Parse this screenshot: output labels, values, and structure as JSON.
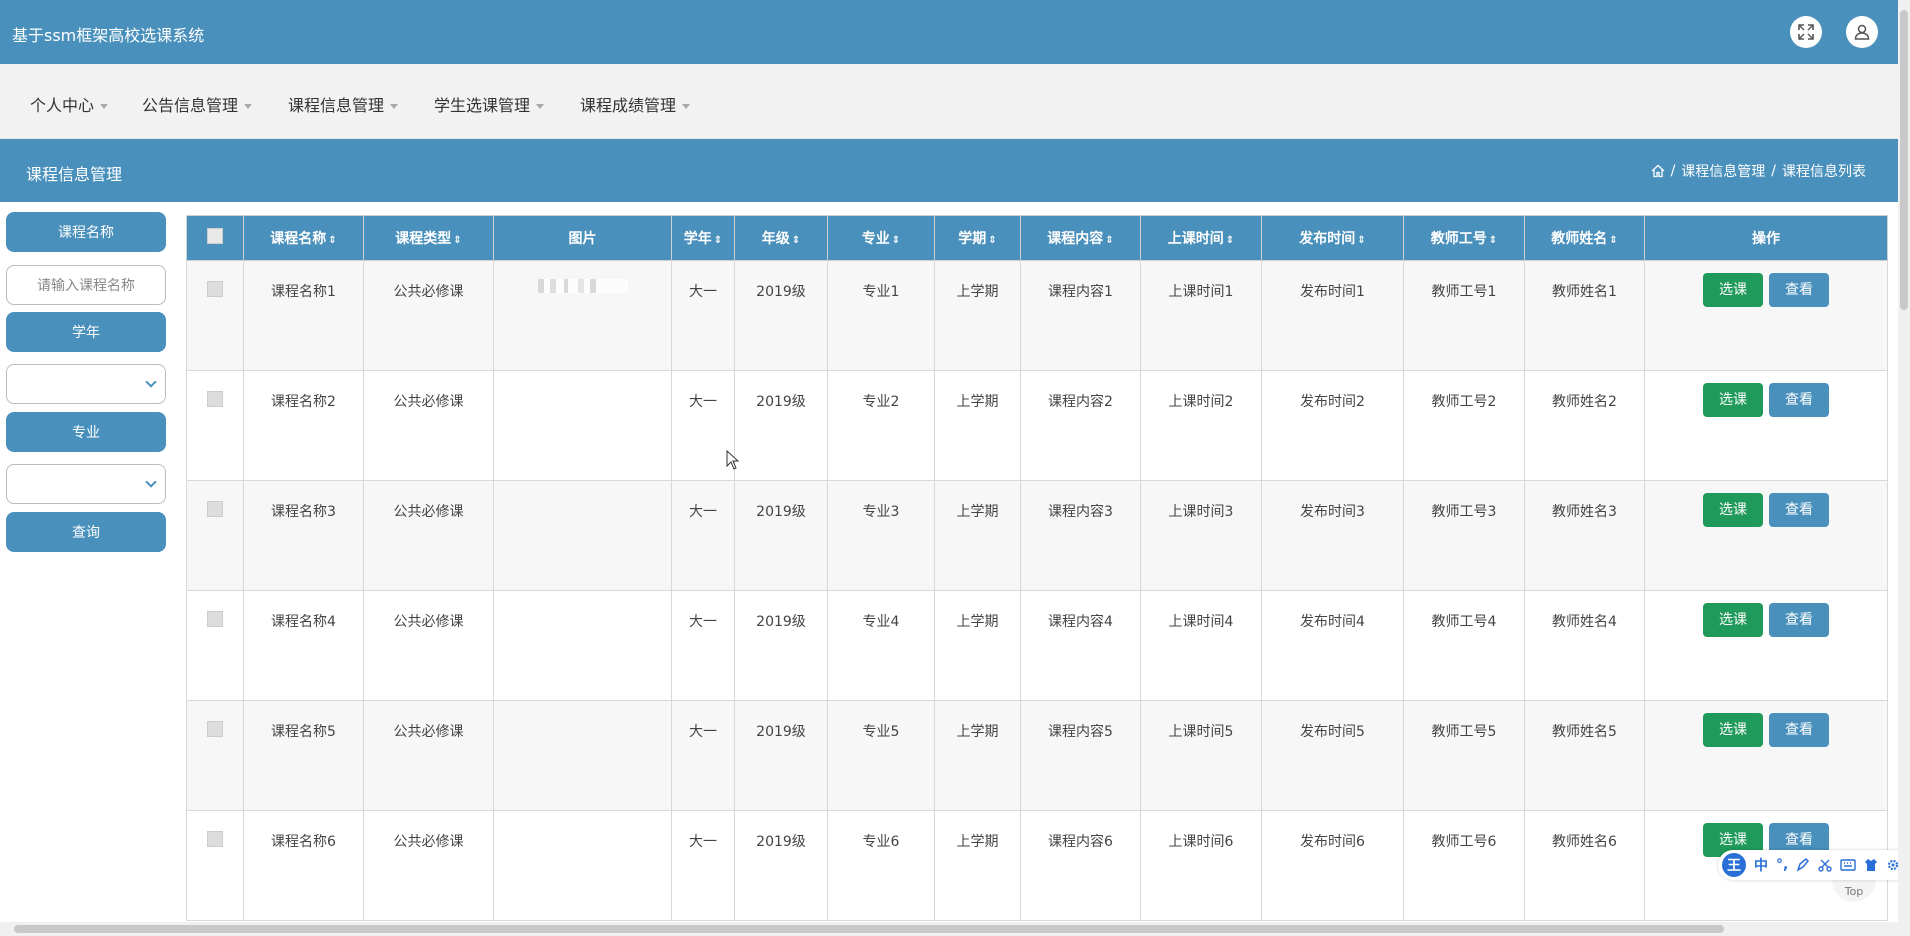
{
  "header": {
    "title": "基于ssm框架高校选课系统"
  },
  "nav": {
    "items": [
      {
        "label": "个人中心"
      },
      {
        "label": "公告信息管理"
      },
      {
        "label": "课程信息管理"
      },
      {
        "label": "学生选课管理"
      },
      {
        "label": "课程成绩管理"
      }
    ]
  },
  "subheader": {
    "title": "课程信息管理",
    "breadcrumb": [
      "课程信息管理",
      "课程信息列表"
    ]
  },
  "sidebar": {
    "course_name_label": "课程名称",
    "course_name_placeholder": "请输入课程名称",
    "year_label": "学年",
    "major_label": "专业",
    "query_button": "查询"
  },
  "table": {
    "headers": [
      "课程名称",
      "课程类型",
      "图片",
      "学年",
      "年级",
      "专业",
      "学期",
      "课程内容",
      "上课时间",
      "发布时间",
      "教师工号",
      "教师姓名",
      "操作"
    ],
    "rows": [
      {
        "name": "课程名称1",
        "type": "公共必修课",
        "year": "大一",
        "grade": "2019级",
        "major": "专业1",
        "term": "上学期",
        "content": "课程内容1",
        "class_time": "上课时间1",
        "publish_time": "发布时间1",
        "teacher_id": "教师工号1",
        "teacher_name": "教师姓名1"
      },
      {
        "name": "课程名称2",
        "type": "公共必修课",
        "year": "大一",
        "grade": "2019级",
        "major": "专业2",
        "term": "上学期",
        "content": "课程内容2",
        "class_time": "上课时间2",
        "publish_time": "发布时间2",
        "teacher_id": "教师工号2",
        "teacher_name": "教师姓名2"
      },
      {
        "name": "课程名称3",
        "type": "公共必修课",
        "year": "大一",
        "grade": "2019级",
        "major": "专业3",
        "term": "上学期",
        "content": "课程内容3",
        "class_time": "上课时间3",
        "publish_time": "发布时间3",
        "teacher_id": "教师工号3",
        "teacher_name": "教师姓名3"
      },
      {
        "name": "课程名称4",
        "type": "公共必修课",
        "year": "大一",
        "grade": "2019级",
        "major": "专业4",
        "term": "上学期",
        "content": "课程内容4",
        "class_time": "上课时间4",
        "publish_time": "发布时间4",
        "teacher_id": "教师工号4",
        "teacher_name": "教师姓名4"
      },
      {
        "name": "课程名称5",
        "type": "公共必修课",
        "year": "大一",
        "grade": "2019级",
        "major": "专业5",
        "term": "上学期",
        "content": "课程内容5",
        "class_time": "上课时间5",
        "publish_time": "发布时间5",
        "teacher_id": "教师工号5",
        "teacher_name": "教师姓名5"
      },
      {
        "name": "课程名称6",
        "type": "公共必修课",
        "year": "大一",
        "grade": "2019级",
        "major": "专业6",
        "term": "上学期",
        "content": "课程内容6",
        "class_time": "上课时间6",
        "publish_time": "发布时间6",
        "teacher_id": "教师工号6",
        "teacher_name": "教师姓名6"
      }
    ],
    "actions": {
      "select_label": "选课",
      "view_label": "查看"
    }
  },
  "ime_toolbar": {
    "logo": "王",
    "mode": "中",
    "punct": "°,",
    "icons": [
      "pen-icon",
      "scissors-icon",
      "keyboard-icon",
      "shirt-icon",
      "gear-icon"
    ]
  },
  "back_to_top": "Top",
  "colors": {
    "primary": "#4a90bc",
    "success": "#1f9a5a",
    "nav_bg": "#f2f2f2"
  }
}
